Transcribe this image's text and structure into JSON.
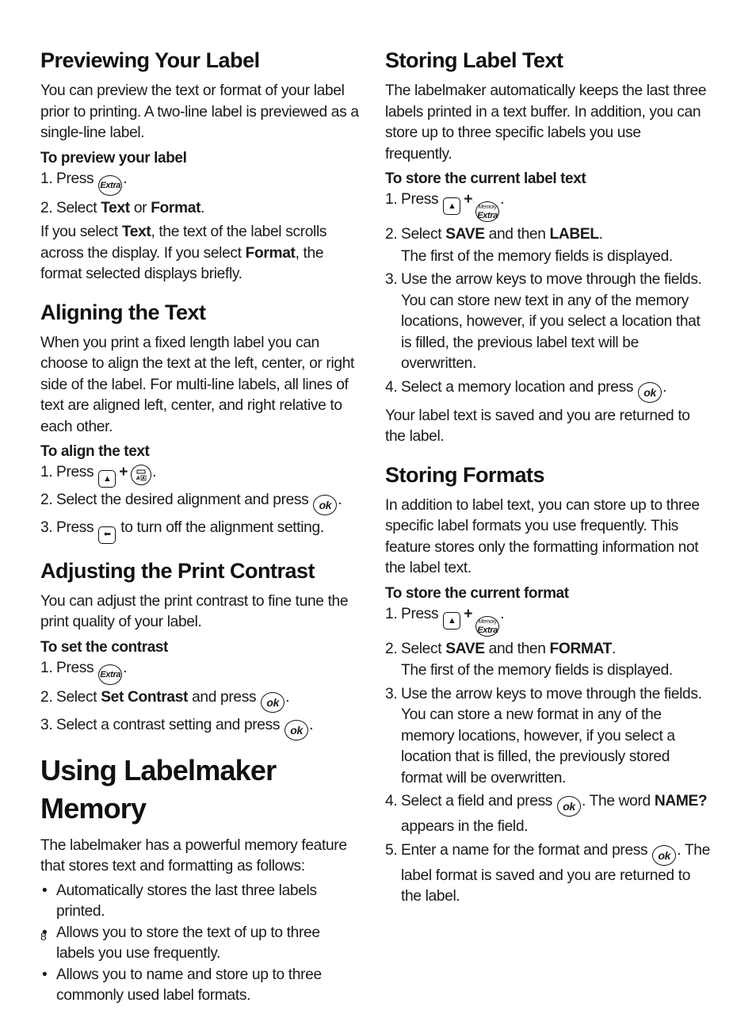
{
  "page_number": "8",
  "left": {
    "previewing": {
      "title": "Previewing Your Label",
      "intro": "You can preview the text or format of your label prior to printing. A two-line label is previewed as a single-line label.",
      "subhead": "To preview your label",
      "step1": {
        "num": "1.",
        "pre": "Press",
        "post": "."
      },
      "step2": {
        "num": "2.",
        "pre": "Select ",
        "b1": "Text",
        "mid": " or ",
        "b2": "Format",
        "post": "."
      },
      "note": {
        "p1": "If you select ",
        "b1": "Text",
        "p2": ", the text of the label scrolls across the display. If you select ",
        "b2": "Format",
        "p3": ", the format selected displays briefly."
      }
    },
    "aligning": {
      "title": "Aligning the Text",
      "intro": "When you print a fixed length label you can choose to align the text at the left, center, or right side of the label. For multi-line labels, all lines of text are aligned left, center, and right relative to each other.",
      "subhead": "To align the text",
      "step1": {
        "num": "1.",
        "pre": "Press",
        "plus": "+",
        "post": "."
      },
      "step2": {
        "num": "2.",
        "pre": "Select the desired alignment and press",
        "post": "."
      },
      "step3": {
        "num": "3.",
        "pre": "Press",
        "post": " to turn off the alignment setting."
      }
    },
    "contrast": {
      "title": "Adjusting the Print Contrast",
      "intro": "You can adjust the print contrast to fine tune the print quality of your label.",
      "subhead": "To set the contrast",
      "step1": {
        "num": "1.",
        "pre": "Press",
        "post": "."
      },
      "step2": {
        "num": "2.",
        "pre": "Select ",
        "b1": "Set Contrast",
        "mid": " and press",
        "post": "."
      },
      "step3": {
        "num": "3.",
        "pre": "Select a contrast setting and press",
        "post": "."
      }
    },
    "memory": {
      "title": "Using Labelmaker Memory",
      "intro": "The labelmaker has a powerful memory feature that stores text and formatting as follows:",
      "bullet": "•",
      "bullets": [
        "Automatically stores the last three labels printed.",
        "Allows you to store the text of up to three labels you use frequently.",
        "Allows you to name and store up to three commonly used label formats."
      ]
    }
  },
  "right": {
    "storing_text": {
      "title": "Storing Label Text",
      "intro": "The labelmaker automatically keeps the last three labels printed in a text buffer. In addition, you can store up to three specific labels you use frequently.",
      "subhead": "To store the current label text",
      "step1": {
        "num": "1.",
        "pre": "Press",
        "plus": "+",
        "post": "."
      },
      "step2": {
        "num": "2.",
        "pre": "Select ",
        "b1": "SAVE",
        "mid": " and then ",
        "b2": "LABEL",
        "post": "."
      },
      "step2_note": "The first of the memory fields is displayed.",
      "step3": {
        "num": "3.",
        "text": "Use the arrow keys to move through the fields. You can store new text in any of the memory locations, however, if you select a location that is filled, the previous label text will be overwritten."
      },
      "step4": {
        "num": "4.",
        "pre": "Select a memory location and press",
        "post": "."
      },
      "outro": "Your label text is saved and you are returned to the label."
    },
    "storing_formats": {
      "title": "Storing Formats",
      "intro": "In addition to label text, you can store up to three specific label formats you use frequently. This feature stores only the formatting information not the label text.",
      "subhead": "To store the current format",
      "step1": {
        "num": "1.",
        "pre": "Press",
        "plus": "+",
        "post": "."
      },
      "step2": {
        "num": "2.",
        "pre": "Select ",
        "b1": "SAVE",
        "mid": " and then ",
        "b2": "FORMAT",
        "post": "."
      },
      "step2_note": "The first of the memory fields is displayed.",
      "step3": {
        "num": "3.",
        "text": "Use the arrow keys to move through the fields. You can store a new format in any of the memory locations, however, if you select a location that is filled, the previously stored format will be overwritten."
      },
      "step4": {
        "num": "4.",
        "pre": "Select a field and press",
        "mid": ". The word ",
        "b1": "NAME?",
        "post": " appears in the field."
      },
      "step5": {
        "num": "5.",
        "pre": "Enter a name for the format and press",
        "post": ". The label format is saved and you are returned to the label."
      }
    }
  },
  "keys": {
    "extra": "Extra",
    "memory_small": "Memory",
    "ok": "ok",
    "up_arrow": "▲",
    "back_arrow": "⬅"
  }
}
